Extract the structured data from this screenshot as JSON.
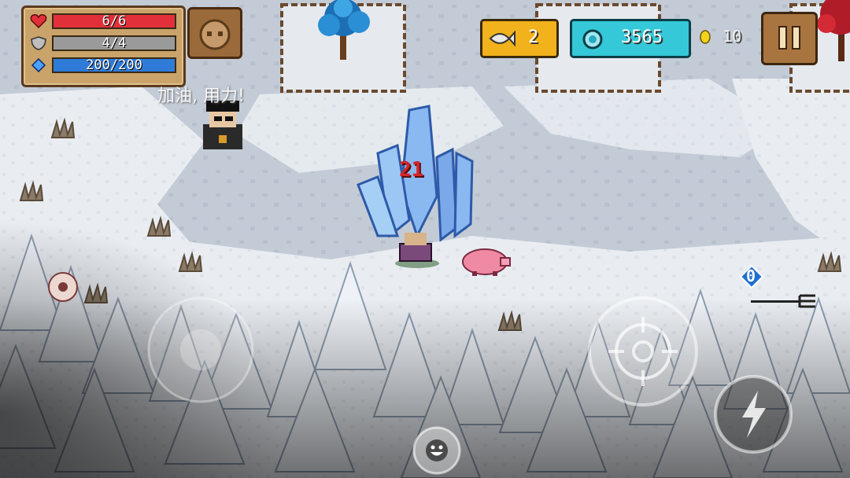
{
  "player": {
    "health_text": "6/6",
    "health_fraction": 1.0,
    "armor_text": "4/4",
    "armor_fraction": 1.0,
    "energy_text": "200/200",
    "energy_fraction": 1.0
  },
  "currency": {
    "fish_count": "2",
    "gem_count": "3565",
    "coin_count": "10"
  },
  "speech_bubble": "加油, 用力!",
  "damage_number": "21",
  "weapon": {
    "energy_cost": "0",
    "icon": "trident-icon"
  },
  "icons": {
    "health": "heart-icon",
    "armor": "shield-icon",
    "energy": "diamond-icon",
    "fish": "fish-icon",
    "gem": "gem-icon",
    "coin": "coin-icon",
    "pause": "pause-icon",
    "skill": "lightning-icon",
    "emote": "smiley-icon",
    "pet_menu": "pet-portrait-icon"
  },
  "colors": {
    "health_bar": "#e2303a",
    "armor_bar": "#9a9a9a",
    "energy_bar": "#2f7bd8",
    "fish_badge": "#f2b21c",
    "gem_badge": "#35c8d8",
    "damage_text": "#d4262a"
  }
}
